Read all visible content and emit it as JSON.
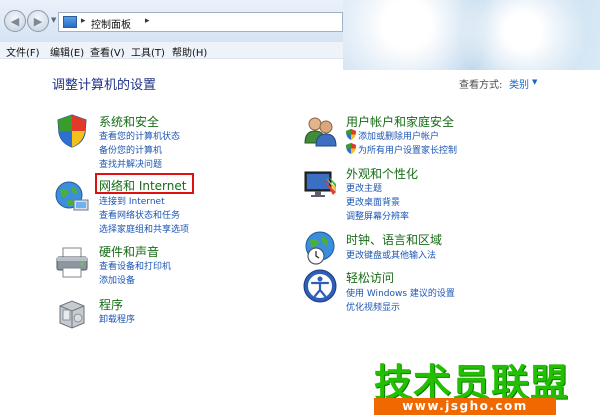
{
  "address_bar": {
    "path_sep": "▸",
    "path_item": "控制面板"
  },
  "menu": [
    {
      "label": "文件(F)"
    },
    {
      "label": "编辑(E)"
    },
    {
      "label": "查看(V)"
    },
    {
      "label": "工具(T)"
    },
    {
      "label": "帮助(H)"
    }
  ],
  "main": {
    "title": "调整计算机的设置",
    "view_by_label": "查看方式:",
    "view_by_value": "类别"
  },
  "categories": [
    {
      "title": "系统和安全",
      "icon": "system-security-shield-icon",
      "links": [
        "查看您的计算机状态",
        "备份您的计算机",
        "查找并解决问题"
      ]
    },
    {
      "title": "网络和 Internet",
      "icon": "network-globe-icon",
      "links": [
        "连接到 Internet",
        "查看网络状态和任务",
        "选择家庭组和共享选项"
      ]
    },
    {
      "title": "硬件和声音",
      "icon": "printer-icon",
      "links": [
        "查看设备和打印机",
        "添加设备"
      ]
    },
    {
      "title": "程序",
      "icon": "programs-box-icon",
      "links": [
        "卸载程序"
      ]
    },
    {
      "title": "用户帐户和家庭安全",
      "icon": "users-icon",
      "links": [
        "添加或删除用户帐户",
        "为所有用户设置家长控制"
      ]
    },
    {
      "title": "外观和个性化",
      "icon": "monitor-palette-icon",
      "links": [
        "更改主题",
        "更改桌面背景",
        "调整屏幕分辨率"
      ]
    },
    {
      "title": "时钟、语言和区域",
      "icon": "clock-globe-icon",
      "links": [
        "更改键盘或其他输入法"
      ]
    },
    {
      "title": "轻松访问",
      "icon": "ease-of-access-icon",
      "links": [
        "使用 Windows 建议的设置",
        "优化视频显示"
      ]
    }
  ],
  "watermark": {
    "logo_text": "技术员联盟",
    "url": "www.jsgho.com"
  },
  "colors": {
    "category_title": "#156b15",
    "link": "#1c56b4",
    "page_title": "#1e3287",
    "highlight": "#e01010",
    "watermark_green": "#22c000",
    "watermark_orange": "#f06800"
  }
}
